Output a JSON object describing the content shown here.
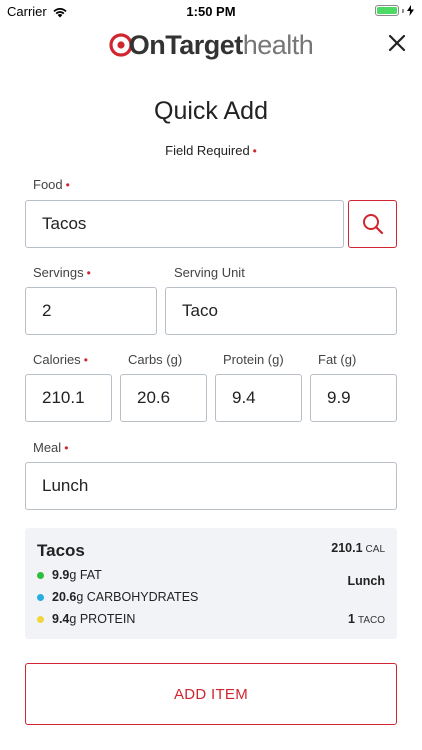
{
  "status_bar": {
    "carrier": "Carrier",
    "time": "1:50 PM"
  },
  "brand": {
    "on": "On",
    "target": "Target",
    "health": "health",
    "accent_color": "#d0262f"
  },
  "page": {
    "title": "Quick Add",
    "required_note": "Field Required",
    "required_marker": "•"
  },
  "form": {
    "food": {
      "label": "Food",
      "value": "Tacos"
    },
    "servings": {
      "label": "Servings",
      "value": "2"
    },
    "serving_unit": {
      "label": "Serving Unit",
      "value": "Taco"
    },
    "calories": {
      "label": "Calories",
      "value": "210.1"
    },
    "carbs": {
      "label": "Carbs (g)",
      "value": "20.6"
    },
    "protein": {
      "label": "Protein (g)",
      "value": "9.4"
    },
    "fat": {
      "label": "Fat (g)",
      "value": "9.9"
    },
    "meal": {
      "label": "Meal",
      "value": "Lunch"
    }
  },
  "summary": {
    "food_name": "Tacos",
    "calories_value": "210.1",
    "calories_unit": "CAL",
    "meal": "Lunch",
    "serving_count": "1",
    "serving_unit": "TACO",
    "macros": [
      {
        "value": "9.9",
        "unit": "g",
        "name": "FAT",
        "color": "#2ebd3c"
      },
      {
        "value": "20.6",
        "unit": "g",
        "name": "CARBOHYDRATES",
        "color": "#27aee0"
      },
      {
        "value": "9.4",
        "unit": "g",
        "name": "PROTEIN",
        "color": "#f2d53c"
      }
    ]
  },
  "actions": {
    "add_item_label": "ADD ITEM"
  }
}
